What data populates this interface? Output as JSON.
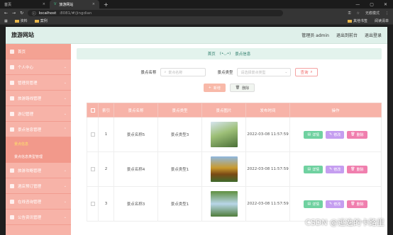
{
  "browser": {
    "tabs": [
      {
        "label": "首页"
      },
      {
        "label": "旅游网站"
      }
    ],
    "url_host": "localhost",
    "url_rest": ":8081/#/jingdian",
    "bookmarks": [
      "资料",
      "案例"
    ],
    "bookmarks_right": [
      "其他书签",
      "阅读清单"
    ],
    "account": "无痕模式"
  },
  "app": {
    "title": "旅游网站",
    "header_links": [
      "管理员 admin",
      "退出到前台",
      "退出登录"
    ]
  },
  "sidebar": {
    "items": [
      {
        "label": "首页"
      },
      {
        "label": "个人中心"
      },
      {
        "label": "管理员管理"
      },
      {
        "label": "旅游路线管理"
      },
      {
        "label": "游记管理"
      },
      {
        "label": "景点信息管理"
      }
    ],
    "sub": [
      {
        "label": "景点信息"
      },
      {
        "label": "景点信息类型管理"
      }
    ],
    "items2": [
      {
        "label": "旅游攻略管理"
      },
      {
        "label": "酒店预订管理"
      },
      {
        "label": "在线咨询管理"
      },
      {
        "label": "公告资讯管理"
      }
    ]
  },
  "breadcrumb": {
    "home": "首页",
    "current": "景点信息"
  },
  "search": {
    "name_label": "景点名称",
    "name_placeholder": "景点名称",
    "type_label": "景点类型",
    "type_placeholder": "请选择景点类型",
    "query": "查询"
  },
  "buttons": {
    "add": "新增",
    "delete": "删除"
  },
  "table": {
    "headers": [
      "索引",
      "景点名称",
      "景点类型",
      "景点图片",
      "发布时间",
      "操作"
    ],
    "rows": [
      {
        "idx": "1",
        "name": "景点名称5",
        "type": "景点类型3",
        "time": "2022-03-08 11:57:59"
      },
      {
        "idx": "2",
        "name": "景点名称4",
        "type": "景点类型1",
        "time": "2022-03-08 11:57:59"
      },
      {
        "idx": "3",
        "name": "景点名称3",
        "type": "景点类型1",
        "time": "2022-03-08 11:57:59"
      }
    ],
    "op_view": "详情",
    "op_edit": "修改",
    "op_del": "删除"
  },
  "watermark": "CSDN @逃逸的卡路里"
}
